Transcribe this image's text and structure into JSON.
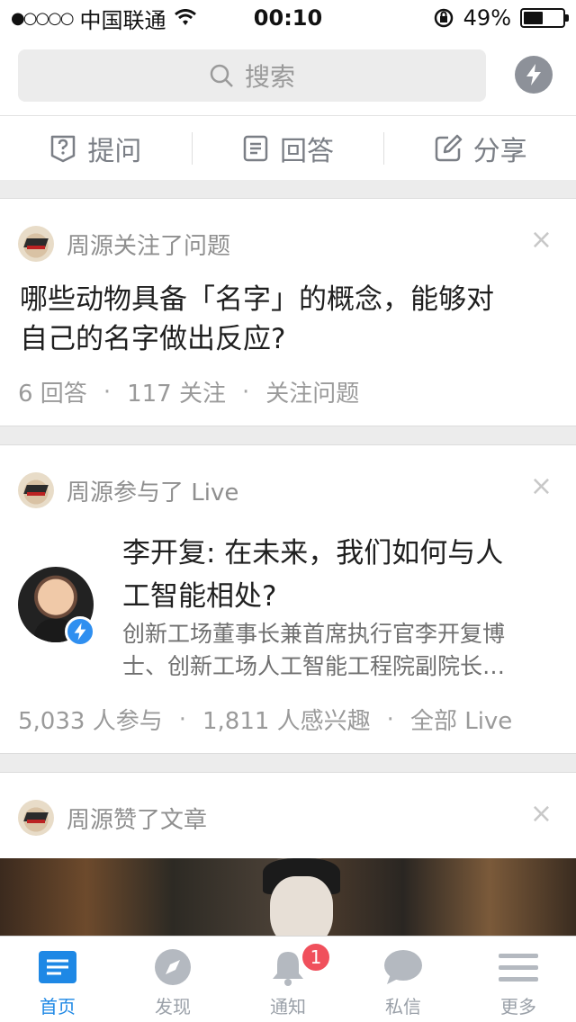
{
  "status_bar": {
    "signal": "●○○○○",
    "carrier": "中国联通",
    "time": "00:10",
    "battery": "49%",
    "battery_level": 0.49
  },
  "search": {
    "placeholder": "搜索"
  },
  "actions": [
    {
      "label": "提问",
      "icon": "question-icon"
    },
    {
      "label": "回答",
      "icon": "document-icon"
    },
    {
      "label": "分享",
      "icon": "edit-icon"
    }
  ],
  "feed": [
    {
      "activity": "周源关注了问题",
      "title_line1": "哪些动物具备「名字」的概念，能够对",
      "title_line2": "自己的名字做出反应?",
      "meta": [
        "6 回答",
        "117 关注",
        "关注问题"
      ]
    },
    {
      "activity": "周源参与了 Live",
      "title_line1": "李开复: 在未来，我们如何与人",
      "title_line2": "工智能相处?",
      "desc_line1": "创新工场董事长兼首席执行官李开复博",
      "desc_line2": "士、创新工场人工智能工程院副院长…",
      "meta": [
        "5,033 人参与",
        "1,811 人感兴趣",
        "全部 Live"
      ]
    },
    {
      "activity": "周源赞了文章"
    }
  ],
  "separator": "·",
  "close_symbol": "×",
  "tabs": [
    {
      "label": "首页",
      "icon": "home-icon",
      "active": true
    },
    {
      "label": "发现",
      "icon": "compass-icon",
      "active": false
    },
    {
      "label": "通知",
      "icon": "bell-icon",
      "active": false,
      "badge": "1"
    },
    {
      "label": "私信",
      "icon": "chat-icon",
      "active": false
    },
    {
      "label": "更多",
      "icon": "menu-icon",
      "active": false
    }
  ],
  "colors": {
    "accent": "#1e88e5",
    "badge": "#f0505c",
    "muted": "#9a9a9a"
  }
}
